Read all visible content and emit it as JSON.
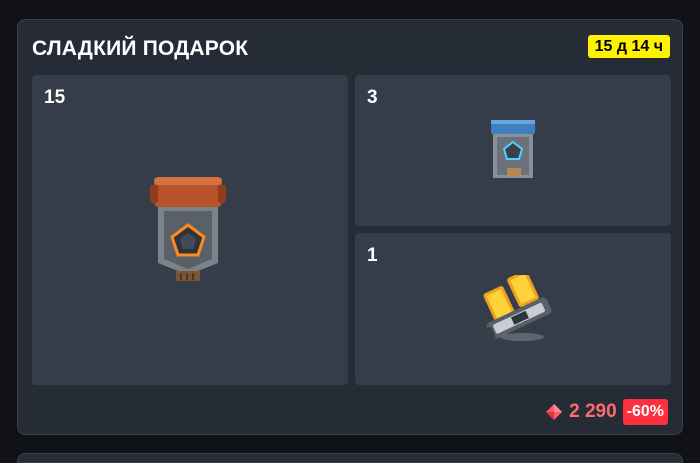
{
  "offer": {
    "title": "СЛАДКИЙ ПОДАРОК",
    "timer": "15 д 14 ч",
    "items": [
      {
        "count": "15",
        "icon": "orange-container-icon"
      },
      {
        "count": "3",
        "icon": "blue-container-icon"
      },
      {
        "count": "1",
        "icon": "booster-module-icon"
      }
    ],
    "price": "2 290",
    "discount": "-60%",
    "currency_icon": "gem-icon"
  },
  "colors": {
    "accent_yellow": "#fff200",
    "price_red": "#ff6b6b",
    "discount_red": "#ff2f3e",
    "card_bg": "#262c36",
    "tile_bg": "#353d4a"
  }
}
